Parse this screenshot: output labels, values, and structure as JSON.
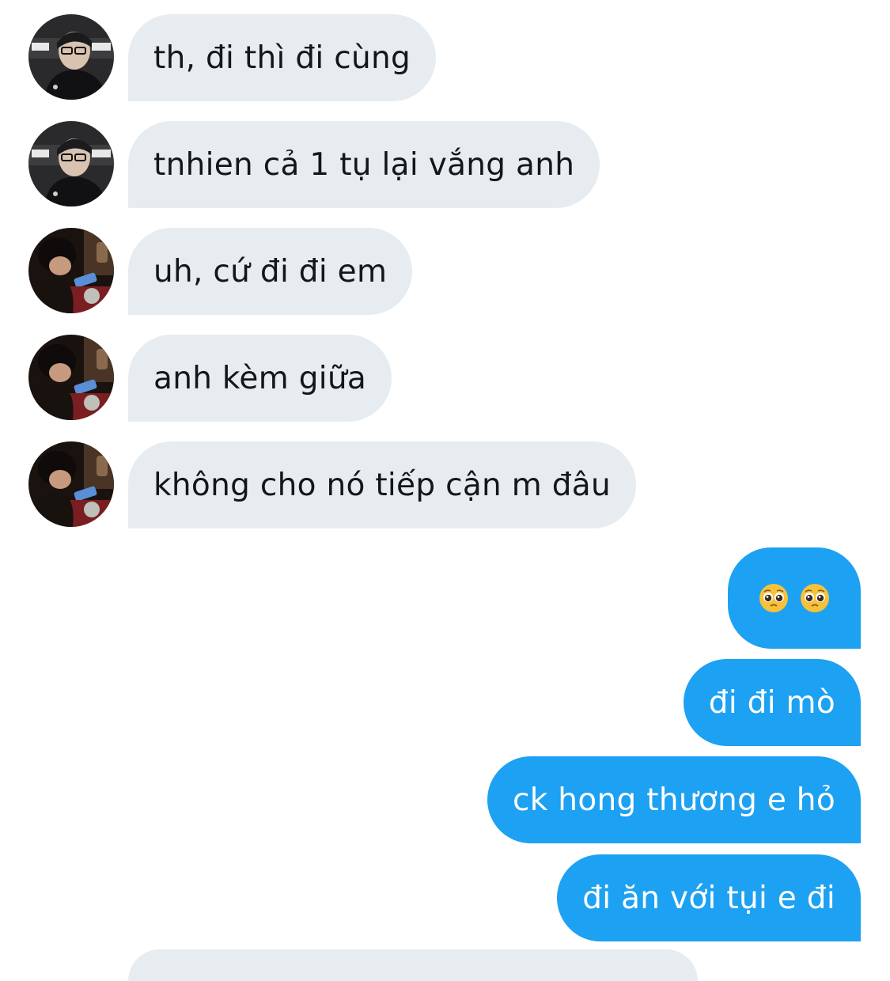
{
  "conversation": {
    "messages": [
      {
        "direction": "in",
        "sender": "user-a",
        "text": "th, đi thì đi cùng"
      },
      {
        "direction": "in",
        "sender": "user-a",
        "text": "tnhien cả 1 tụ lại vắng anh"
      },
      {
        "direction": "in",
        "sender": "user-b",
        "text": "uh, cứ đi đi em"
      },
      {
        "direction": "in",
        "sender": "user-b",
        "text": "anh kèm giữa"
      },
      {
        "direction": "in",
        "sender": "user-b",
        "text": "không cho nó tiếp cận m đâu"
      },
      {
        "direction": "out",
        "sender": "me",
        "emoji": [
          "pleading-face-emoji",
          "pleading-face-emoji"
        ]
      },
      {
        "direction": "out",
        "sender": "me",
        "text": "đi đi mò"
      },
      {
        "direction": "out",
        "sender": "me",
        "text": "ck hong thương e hỏ"
      },
      {
        "direction": "out",
        "sender": "me",
        "text": "đi ăn với tụi e đi"
      }
    ]
  },
  "colors": {
    "incoming_bubble": "#e6ecf0",
    "incoming_text": "#14171a",
    "outgoing_bubble": "#1da1f2",
    "outgoing_text": "#ffffff",
    "background": "#ffffff"
  }
}
